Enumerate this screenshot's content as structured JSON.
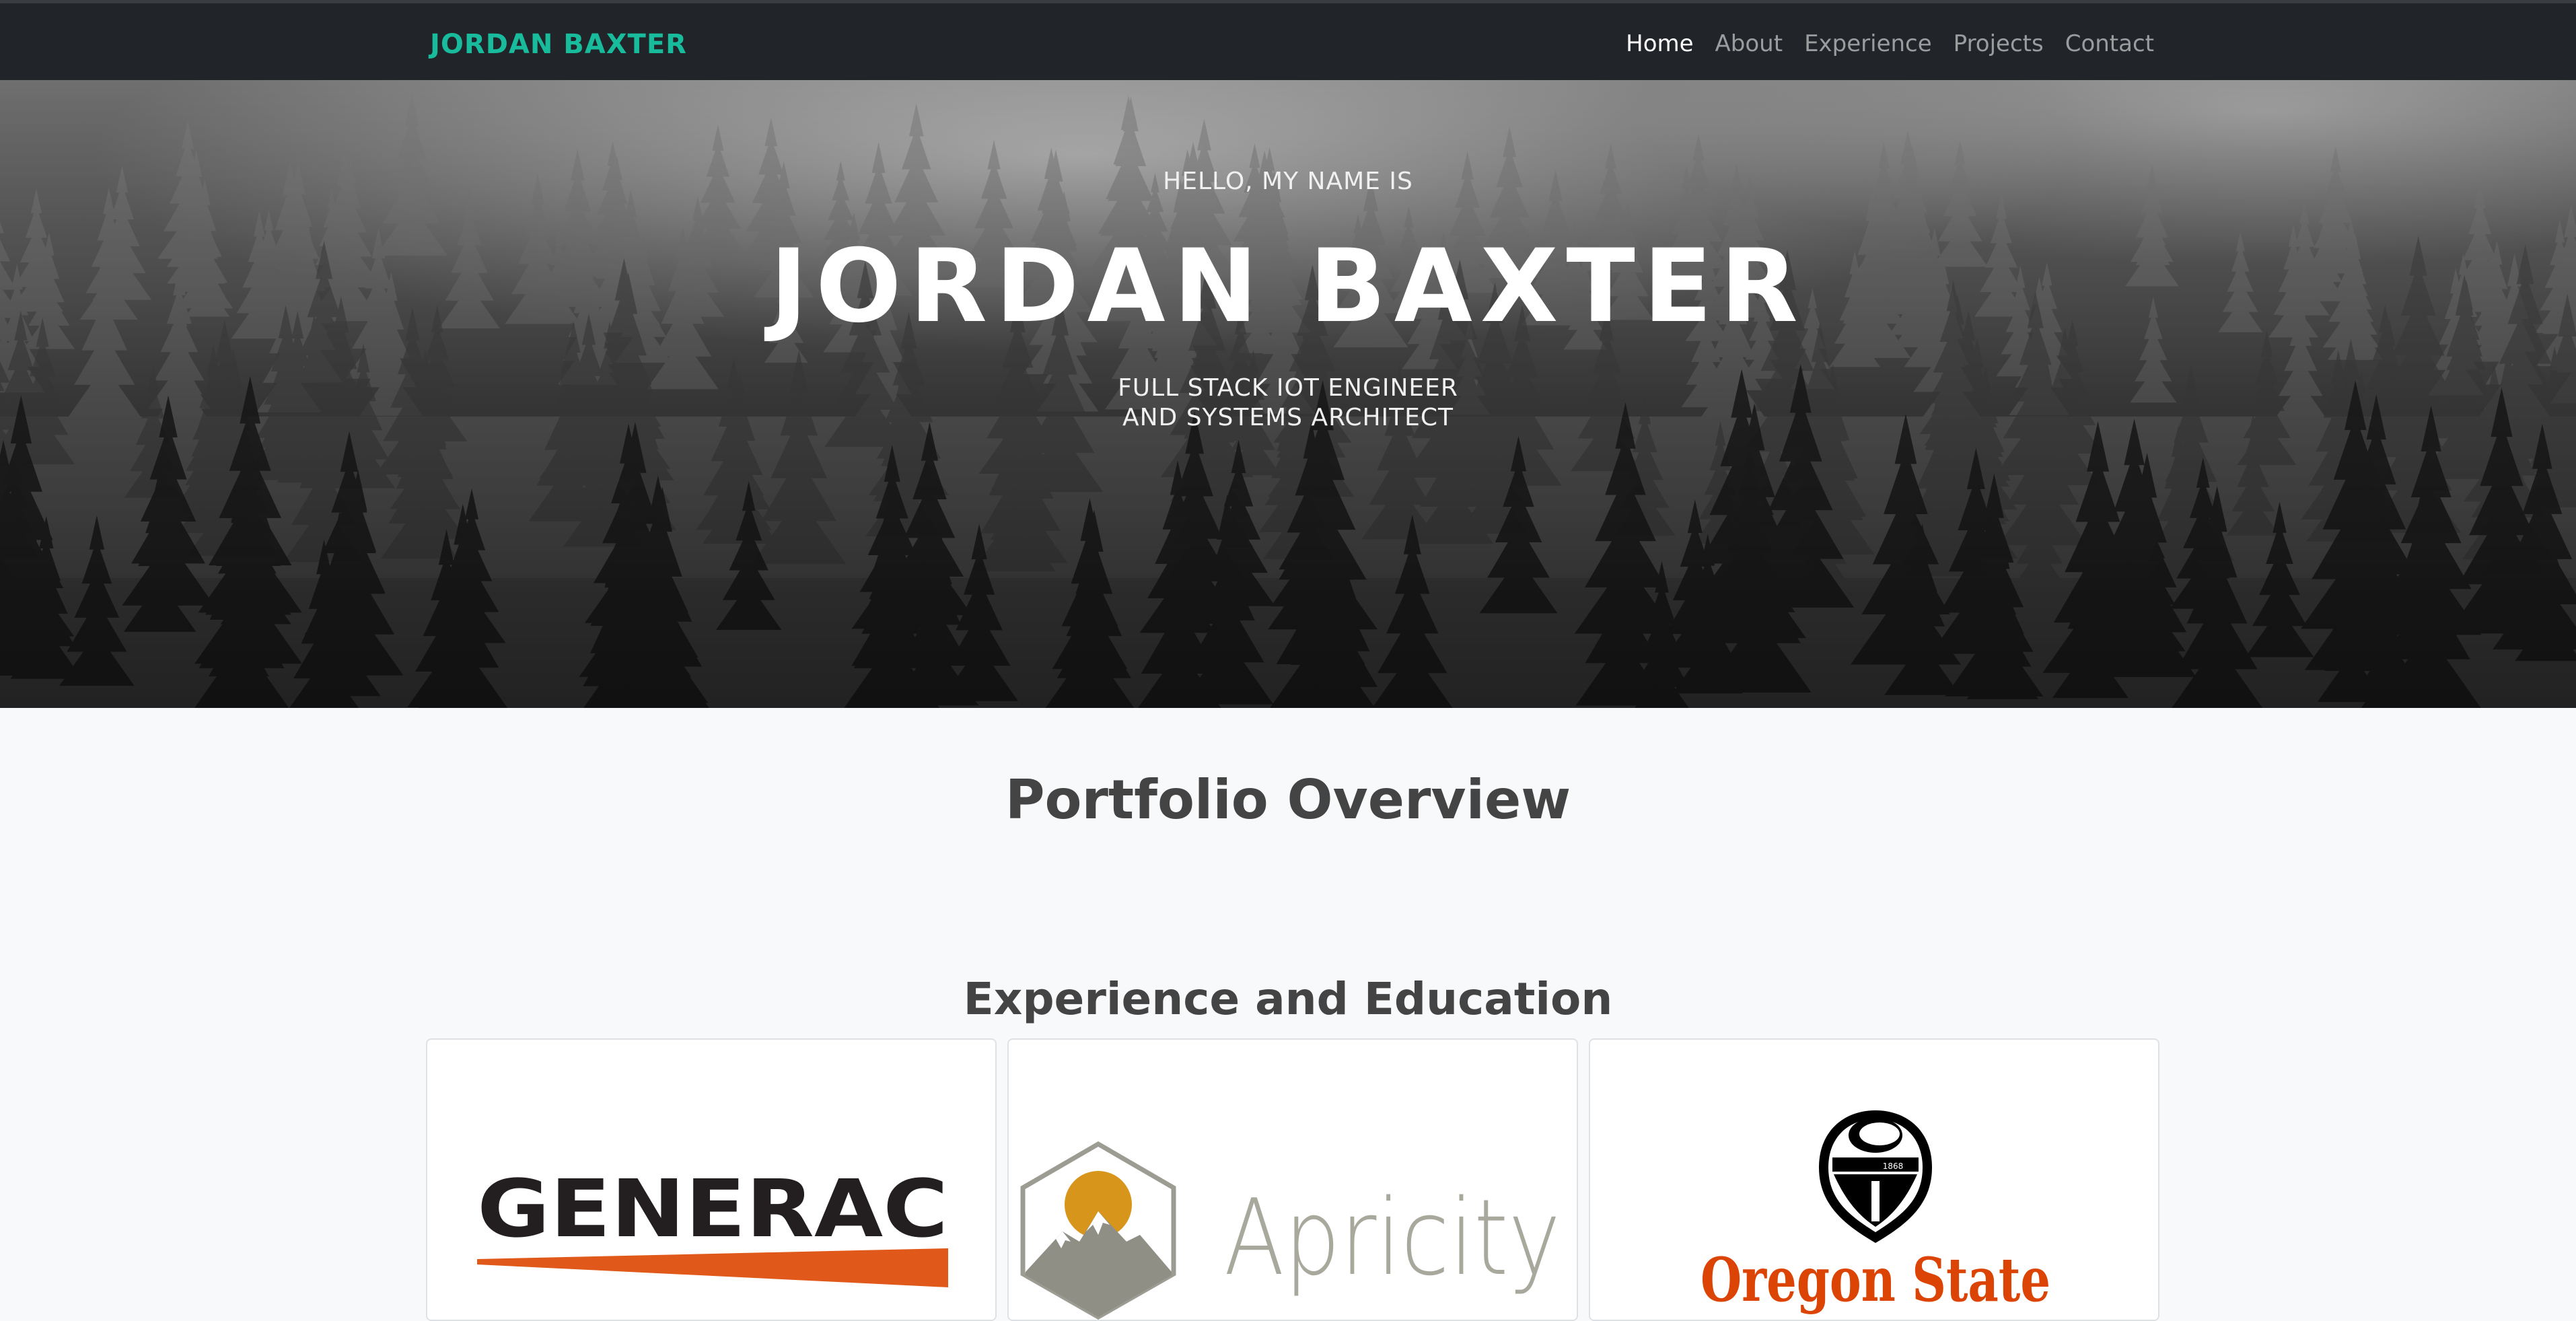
{
  "navbar": {
    "brand": "JORDAN BAXTER",
    "links": [
      "Home",
      "About",
      "Experience",
      "Projects",
      "Contact"
    ],
    "active": "Home"
  },
  "hero": {
    "greeting": "HELLO, MY NAME IS",
    "name": "JORDAN BAXTER",
    "role_line1": "FULL STACK IOT ENGINEER",
    "role_line2": "AND SYSTEMS ARCHITECT"
  },
  "sections": {
    "overview_title": "Portfolio Overview",
    "experience_title": "Experience and Education"
  },
  "cards": [
    {
      "logo_text": "GENERAC"
    },
    {
      "logo_text": "Apricity"
    },
    {
      "logo_text": "Oregon State",
      "seal_year": "1868"
    }
  ],
  "colors": {
    "brand": "#18bc9c",
    "navbar": "#212529",
    "generac_orange": "#e0591a",
    "oregon_orange": "#dc4405",
    "apricity_gold": "#d8951b"
  }
}
